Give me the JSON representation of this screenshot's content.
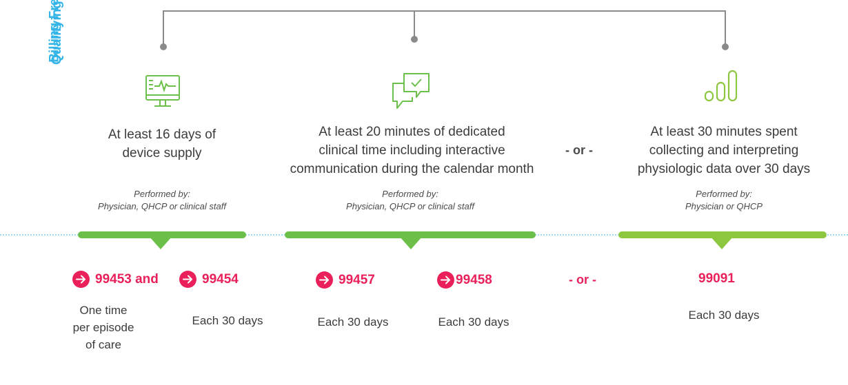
{
  "side_labels": {
    "qualifying_activity": "Qualifying Activity",
    "billing_frequency": "Billing Frequency"
  },
  "activities": [
    {
      "icon": "monitor-heartbeat-icon",
      "lines": [
        "At least 16 days of",
        "device supply"
      ],
      "performed_by": [
        "Performed by:",
        "Physician, QHCP or clinical staff"
      ]
    },
    {
      "icon": "chat-check-icon",
      "lines": [
        "At least 20 minutes of dedicated",
        "clinical time including interactive",
        "communication during the calendar month"
      ],
      "performed_by": [
        "Performed by:",
        "Physician, QHCP or clinical staff"
      ]
    },
    {
      "icon": "bar-chart-icon",
      "lines": [
        "At least 30 minutes spent",
        "collecting and interpreting",
        "physiologic data over 30 days"
      ],
      "performed_by": [
        "Performed by:",
        "Physician or QHCP"
      ]
    }
  ],
  "or_separator": "- or -",
  "billing": {
    "codes": {
      "c99453": "99453 and",
      "c99454": "99454",
      "c99457": "99457",
      "c99458": "99458",
      "c99091": "99091"
    },
    "or_separator": "- or -",
    "frequencies": {
      "f99453": [
        "One time",
        "per episode",
        "of care"
      ],
      "f99454": "Each 30 days",
      "f99457": "Each 30 days",
      "f99458": "Each 30 days",
      "f99091": "Each 30 days"
    }
  },
  "colors": {
    "accent_blue": "#35b4e8",
    "green": "#6cc04a",
    "green_right": "#8dc63f",
    "code_pink": "#e9205a",
    "connector_gray": "#8a8a8a"
  }
}
